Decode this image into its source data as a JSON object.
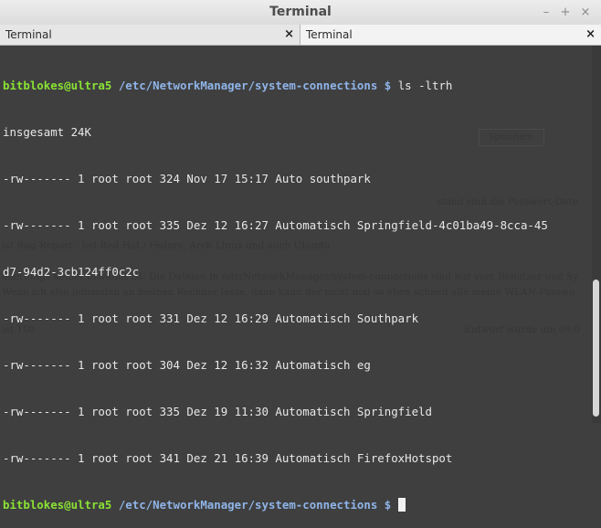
{
  "window": {
    "title": "Terminal",
    "minimize": "–",
    "maximize": "+",
    "close": "×"
  },
  "tabs": [
    {
      "label": "Terminal",
      "close": "×",
      "active": false
    },
    {
      "label": "Terminal",
      "close": "×",
      "active": true
    }
  ],
  "terminal": {
    "prompt_user": "bitblokes@ultra5",
    "prompt_path": "/etc/NetworkManager/system-connections",
    "prompt_symbol": "$",
    "command": "ls -ltrh",
    "total": "insgesamt 24K",
    "listing": [
      "-rw------- 1 root root 324 Nov 17 15:17 Auto southpark",
      "-rw------- 1 root root 335 Dez 12 16:27 Automatisch Springfield-4c01ba49-8cca-45",
      "d7-94d2-3cb124ff0c2c",
      "-rw------- 1 root root 331 Dez 12 16:29 Automatisch Southpark",
      "-rw------- 1 root root 304 Dez 12 16:32 Automatisch eg",
      "-rw------- 1 root root 335 Dez 19 11:30 Automatisch Springfield",
      "-rw------- 1 root root 341 Dez 21 16:39 Automatisch FirefoxHotspot"
    ]
  },
  "background_page": {
    "button_save": "Speichern",
    "line1_right": "stand sind die Passwort-Date",
    "line2": "ist Bug-Report - bei Red Hat / Fedora, Arch Linux und auch Ubuntu",
    "line3": "allerdings keiner erwähnt ist: Die Dateien in /etc/NetworkManager/system-connections sind nur vom Benutzer und Sy",
    "line4": "Wenn ich also jemanden an meinen Rechner lasse, dann kann der nicht mal so eben schnell alle meine WLAN-Passwo",
    "footer_left": "ist 100",
    "footer_right": "Entwurf wurde um 09:0"
  }
}
